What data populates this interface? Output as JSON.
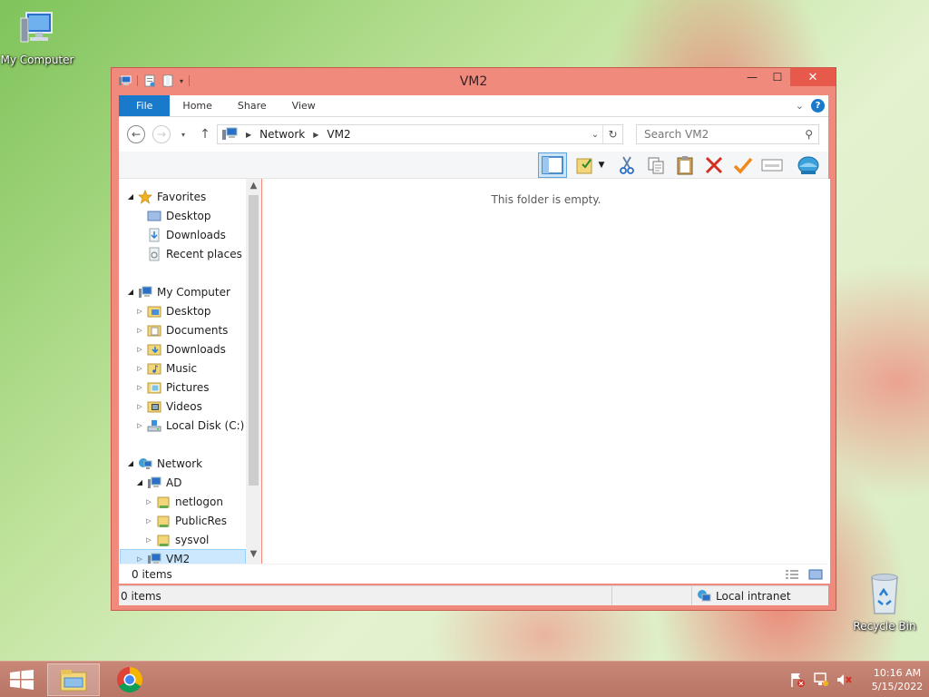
{
  "desktop": {
    "my_computer_label": "My Computer",
    "recycle_bin_label": "Recycle Bin"
  },
  "window": {
    "title": "VM2",
    "caption": {
      "minimize": "—",
      "maximize": "☐",
      "close": "✕"
    }
  },
  "ribbon": {
    "tabs": [
      "File",
      "Home",
      "Share",
      "View"
    ]
  },
  "address": {
    "crumbs": [
      "Network",
      "VM2"
    ]
  },
  "search": {
    "placeholder": "Search VM2"
  },
  "nav": {
    "favorites": {
      "label": "Favorites",
      "items": [
        "Desktop",
        "Downloads",
        "Recent places"
      ]
    },
    "my_computer": {
      "label": "My Computer",
      "items": [
        "Desktop",
        "Documents",
        "Downloads",
        "Music",
        "Pictures",
        "Videos",
        "Local Disk (C:)"
      ]
    },
    "network": {
      "label": "Network",
      "ad": {
        "label": "AD",
        "items": [
          "netlogon",
          "PublicRes",
          "sysvol"
        ]
      },
      "vm2": "VM2"
    }
  },
  "content": {
    "empty_message": "This folder is empty."
  },
  "details": {
    "items_count": "0 items"
  },
  "status": {
    "items_count": "0 items",
    "zone": "Local intranet"
  },
  "taskbar": {
    "time": "10:16 AM",
    "date": "5/15/2022"
  },
  "colors": {
    "window_frame": "#f08a7c",
    "close_button": "#e6594b",
    "file_tab": "#1979ca",
    "selection": "#cce8ff",
    "taskbar": "#c88777"
  }
}
